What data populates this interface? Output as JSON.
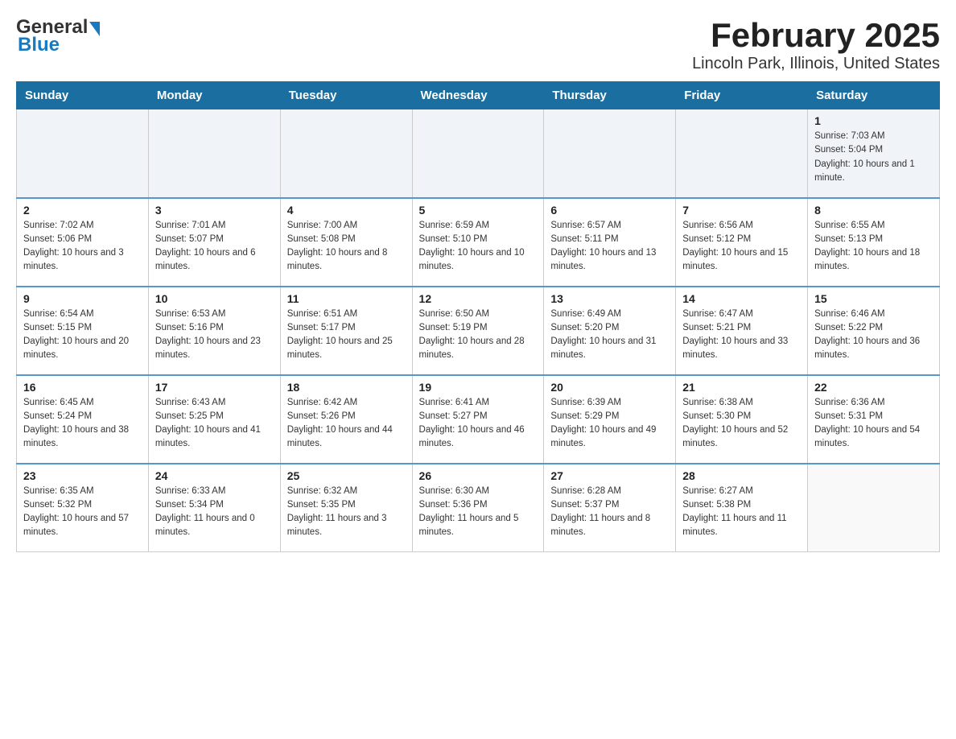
{
  "logo": {
    "text_general": "General",
    "text_blue": "Blue"
  },
  "title": "February 2025",
  "subtitle": "Lincoln Park, Illinois, United States",
  "days_of_week": [
    "Sunday",
    "Monday",
    "Tuesday",
    "Wednesday",
    "Thursday",
    "Friday",
    "Saturday"
  ],
  "weeks": [
    [
      {
        "day": "",
        "sunrise": "",
        "sunset": "",
        "daylight": ""
      },
      {
        "day": "",
        "sunrise": "",
        "sunset": "",
        "daylight": ""
      },
      {
        "day": "",
        "sunrise": "",
        "sunset": "",
        "daylight": ""
      },
      {
        "day": "",
        "sunrise": "",
        "sunset": "",
        "daylight": ""
      },
      {
        "day": "",
        "sunrise": "",
        "sunset": "",
        "daylight": ""
      },
      {
        "day": "",
        "sunrise": "",
        "sunset": "",
        "daylight": ""
      },
      {
        "day": "1",
        "sunrise": "Sunrise: 7:03 AM",
        "sunset": "Sunset: 5:04 PM",
        "daylight": "Daylight: 10 hours and 1 minute."
      }
    ],
    [
      {
        "day": "2",
        "sunrise": "Sunrise: 7:02 AM",
        "sunset": "Sunset: 5:06 PM",
        "daylight": "Daylight: 10 hours and 3 minutes."
      },
      {
        "day": "3",
        "sunrise": "Sunrise: 7:01 AM",
        "sunset": "Sunset: 5:07 PM",
        "daylight": "Daylight: 10 hours and 6 minutes."
      },
      {
        "day": "4",
        "sunrise": "Sunrise: 7:00 AM",
        "sunset": "Sunset: 5:08 PM",
        "daylight": "Daylight: 10 hours and 8 minutes."
      },
      {
        "day": "5",
        "sunrise": "Sunrise: 6:59 AM",
        "sunset": "Sunset: 5:10 PM",
        "daylight": "Daylight: 10 hours and 10 minutes."
      },
      {
        "day": "6",
        "sunrise": "Sunrise: 6:57 AM",
        "sunset": "Sunset: 5:11 PM",
        "daylight": "Daylight: 10 hours and 13 minutes."
      },
      {
        "day": "7",
        "sunrise": "Sunrise: 6:56 AM",
        "sunset": "Sunset: 5:12 PM",
        "daylight": "Daylight: 10 hours and 15 minutes."
      },
      {
        "day": "8",
        "sunrise": "Sunrise: 6:55 AM",
        "sunset": "Sunset: 5:13 PM",
        "daylight": "Daylight: 10 hours and 18 minutes."
      }
    ],
    [
      {
        "day": "9",
        "sunrise": "Sunrise: 6:54 AM",
        "sunset": "Sunset: 5:15 PM",
        "daylight": "Daylight: 10 hours and 20 minutes."
      },
      {
        "day": "10",
        "sunrise": "Sunrise: 6:53 AM",
        "sunset": "Sunset: 5:16 PM",
        "daylight": "Daylight: 10 hours and 23 minutes."
      },
      {
        "day": "11",
        "sunrise": "Sunrise: 6:51 AM",
        "sunset": "Sunset: 5:17 PM",
        "daylight": "Daylight: 10 hours and 25 minutes."
      },
      {
        "day": "12",
        "sunrise": "Sunrise: 6:50 AM",
        "sunset": "Sunset: 5:19 PM",
        "daylight": "Daylight: 10 hours and 28 minutes."
      },
      {
        "day": "13",
        "sunrise": "Sunrise: 6:49 AM",
        "sunset": "Sunset: 5:20 PM",
        "daylight": "Daylight: 10 hours and 31 minutes."
      },
      {
        "day": "14",
        "sunrise": "Sunrise: 6:47 AM",
        "sunset": "Sunset: 5:21 PM",
        "daylight": "Daylight: 10 hours and 33 minutes."
      },
      {
        "day": "15",
        "sunrise": "Sunrise: 6:46 AM",
        "sunset": "Sunset: 5:22 PM",
        "daylight": "Daylight: 10 hours and 36 minutes."
      }
    ],
    [
      {
        "day": "16",
        "sunrise": "Sunrise: 6:45 AM",
        "sunset": "Sunset: 5:24 PM",
        "daylight": "Daylight: 10 hours and 38 minutes."
      },
      {
        "day": "17",
        "sunrise": "Sunrise: 6:43 AM",
        "sunset": "Sunset: 5:25 PM",
        "daylight": "Daylight: 10 hours and 41 minutes."
      },
      {
        "day": "18",
        "sunrise": "Sunrise: 6:42 AM",
        "sunset": "Sunset: 5:26 PM",
        "daylight": "Daylight: 10 hours and 44 minutes."
      },
      {
        "day": "19",
        "sunrise": "Sunrise: 6:41 AM",
        "sunset": "Sunset: 5:27 PM",
        "daylight": "Daylight: 10 hours and 46 minutes."
      },
      {
        "day": "20",
        "sunrise": "Sunrise: 6:39 AM",
        "sunset": "Sunset: 5:29 PM",
        "daylight": "Daylight: 10 hours and 49 minutes."
      },
      {
        "day": "21",
        "sunrise": "Sunrise: 6:38 AM",
        "sunset": "Sunset: 5:30 PM",
        "daylight": "Daylight: 10 hours and 52 minutes."
      },
      {
        "day": "22",
        "sunrise": "Sunrise: 6:36 AM",
        "sunset": "Sunset: 5:31 PM",
        "daylight": "Daylight: 10 hours and 54 minutes."
      }
    ],
    [
      {
        "day": "23",
        "sunrise": "Sunrise: 6:35 AM",
        "sunset": "Sunset: 5:32 PM",
        "daylight": "Daylight: 10 hours and 57 minutes."
      },
      {
        "day": "24",
        "sunrise": "Sunrise: 6:33 AM",
        "sunset": "Sunset: 5:34 PM",
        "daylight": "Daylight: 11 hours and 0 minutes."
      },
      {
        "day": "25",
        "sunrise": "Sunrise: 6:32 AM",
        "sunset": "Sunset: 5:35 PM",
        "daylight": "Daylight: 11 hours and 3 minutes."
      },
      {
        "day": "26",
        "sunrise": "Sunrise: 6:30 AM",
        "sunset": "Sunset: 5:36 PM",
        "daylight": "Daylight: 11 hours and 5 minutes."
      },
      {
        "day": "27",
        "sunrise": "Sunrise: 6:28 AM",
        "sunset": "Sunset: 5:37 PM",
        "daylight": "Daylight: 11 hours and 8 minutes."
      },
      {
        "day": "28",
        "sunrise": "Sunrise: 6:27 AM",
        "sunset": "Sunset: 5:38 PM",
        "daylight": "Daylight: 11 hours and 11 minutes."
      },
      {
        "day": "",
        "sunrise": "",
        "sunset": "",
        "daylight": ""
      }
    ]
  ]
}
